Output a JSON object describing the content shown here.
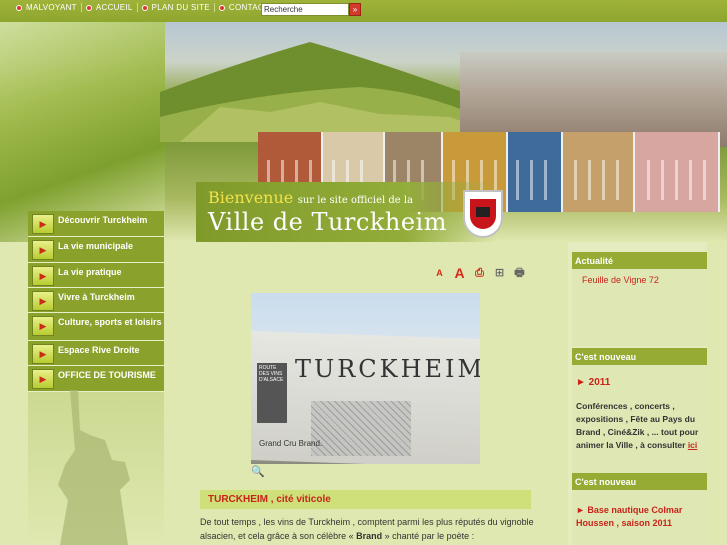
{
  "topbar": {
    "links": [
      {
        "label": "MALVOYANT"
      },
      {
        "label": "ACCUEIL"
      },
      {
        "label": "PLAN DU SITE"
      },
      {
        "label": "CONTACT"
      }
    ],
    "search_value": "Recherche",
    "search_button": "»"
  },
  "banner": {
    "welcome_big": "Bienvenue",
    "welcome_small": "sur le site officiel de la",
    "city": "Ville de Turckheim"
  },
  "menu": {
    "items": [
      {
        "label": "Découvrir Turckheim"
      },
      {
        "label": "La vie municipale"
      },
      {
        "label": "La vie pratique"
      },
      {
        "label": "Vivre à Turckheim"
      },
      {
        "label": "Culture, sports et loisirs"
      },
      {
        "label": "Espace Rive Droite"
      },
      {
        "label": "OFFICE DE TOURISME"
      }
    ],
    "arrow_glyph": "▶"
  },
  "tools": {
    "text_small": "A",
    "text_large": "A",
    "pdf": "⎙",
    "tree": "⊞",
    "print": "🖶"
  },
  "photo": {
    "sign_title": "TURCKHEIM",
    "sign_logo": "ROUTE DES VINS D'ALSACE",
    "sign_subtitle": "Grand Cru Brand."
  },
  "zoom_icon": "🔍",
  "content": {
    "title": "TURCKHEIM , cité viticole",
    "text_1": "De tout temps , les vins de Turckheim , comptent parmi les plus réputés du vignoble alsacien, et cela grâce à son célèbre « ",
    "text_bold": "Brand",
    "text_2": " » chanté par le poète :"
  },
  "right": {
    "actualite_title": "Actualité",
    "actualite_link": "Feuille de Vigne 72",
    "nouveau1_title": "C'est nouveau",
    "nouveau1_year": "► 2011",
    "nouveau1_text": "Conférences , concerts , expositions , Fête au Pays du Brand , Ciné&Zik , ... tout pour animer la Ville , à consulter ",
    "nouveau1_link": "ici",
    "nouveau2_title": "C'est nouveau",
    "nouveau2_link": "► Base nautique Colmar Houssen , saison 2011"
  },
  "colors": {
    "green_dark": "#8aa22c",
    "green_light": "#dfe8b0",
    "accent_red": "#c8241a"
  }
}
